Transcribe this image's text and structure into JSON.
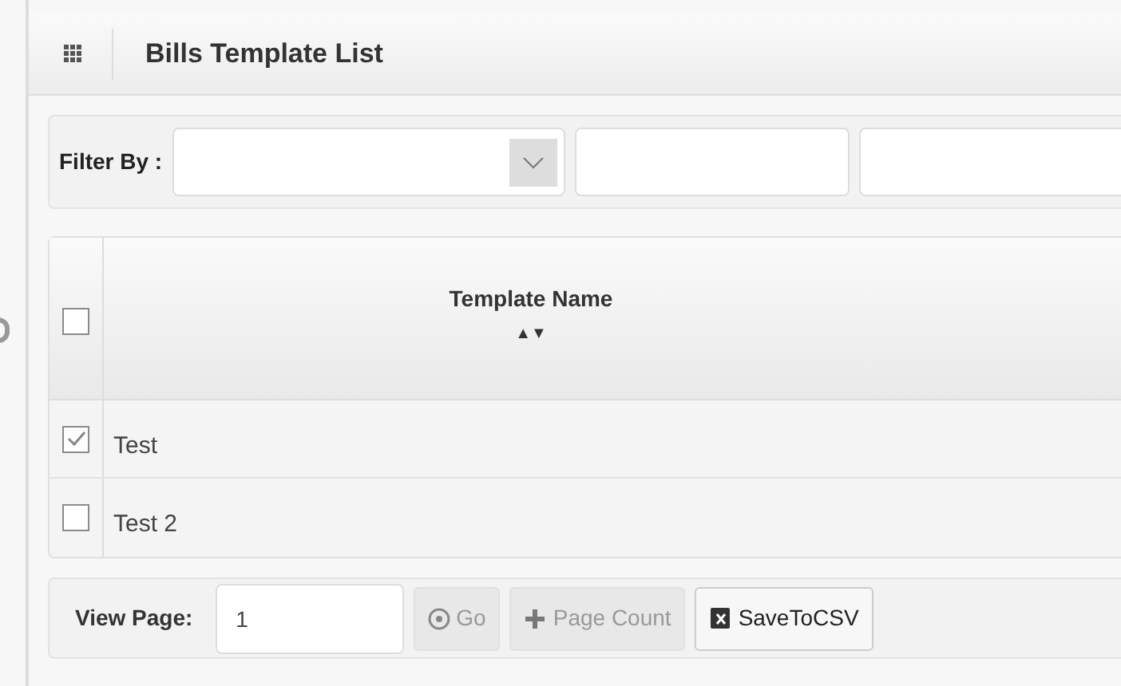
{
  "header": {
    "title": "Bills Template List"
  },
  "filter": {
    "label": "Filter By :"
  },
  "table": {
    "header_checked": false,
    "columns": [
      {
        "label": "Template Name",
        "sort": "▲▼"
      }
    ],
    "rows": [
      {
        "name": "Test",
        "checked": true
      },
      {
        "name": "Test 2",
        "checked": false
      }
    ]
  },
  "footer": {
    "label": "View Page:",
    "page": "1",
    "buttons": [
      {
        "label": "Go",
        "kind": "go",
        "disabled": true
      },
      {
        "label": "Page Count",
        "kind": "count",
        "disabled": true
      },
      {
        "label": "SaveToCSV",
        "kind": "csv",
        "disabled": false
      }
    ]
  }
}
